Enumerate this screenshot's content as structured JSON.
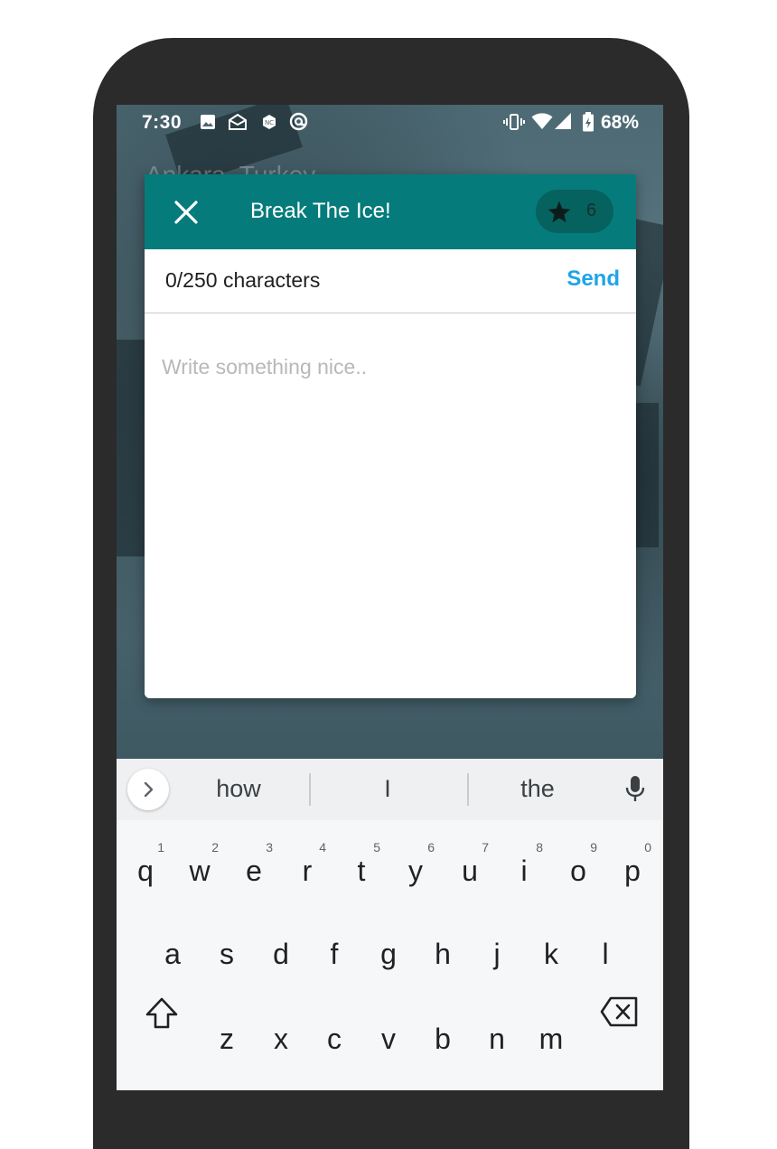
{
  "status_bar": {
    "time": "7:30",
    "battery_percent": "68%",
    "icons": [
      "image-icon",
      "email-open-icon",
      "app-badge-icon",
      "at-sign-icon",
      "vibrate-icon",
      "wifi-icon",
      "signal-icon",
      "battery-charging-icon"
    ]
  },
  "background": {
    "location_text": "Ankara, Turkey"
  },
  "dialog": {
    "title": "Break The Ice!",
    "credits_count": "6",
    "char_counter": "0/250 characters",
    "send_label": "Send",
    "message_placeholder": "Write something nice..",
    "message_value": "",
    "header_color": "#067b7b",
    "send_color": "#1ea4e9"
  },
  "keyboard": {
    "suggestions": [
      "how",
      "I",
      "the"
    ],
    "row1": [
      {
        "key": "q",
        "hint": "1"
      },
      {
        "key": "w",
        "hint": "2"
      },
      {
        "key": "e",
        "hint": "3"
      },
      {
        "key": "r",
        "hint": "4"
      },
      {
        "key": "t",
        "hint": "5"
      },
      {
        "key": "y",
        "hint": "6"
      },
      {
        "key": "u",
        "hint": "7"
      },
      {
        "key": "i",
        "hint": "8"
      },
      {
        "key": "o",
        "hint": "9"
      },
      {
        "key": "p",
        "hint": "0"
      }
    ],
    "row2": [
      "a",
      "s",
      "d",
      "f",
      "g",
      "h",
      "j",
      "k",
      "l"
    ],
    "row3": [
      "z",
      "x",
      "c",
      "v",
      "b",
      "n",
      "m"
    ]
  }
}
